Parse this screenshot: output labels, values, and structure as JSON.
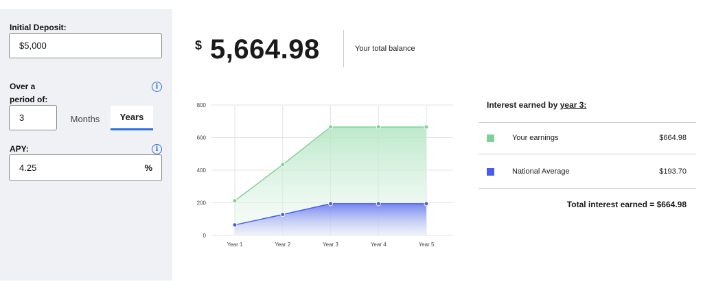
{
  "form": {
    "deposit_label": "Initial Deposit:",
    "deposit_value": "$5,000",
    "period_label_line1": "Over a",
    "period_label_line2": "period of:",
    "period_value": "3",
    "tab_months": "Months",
    "tab_years": "Years",
    "selected_tab": "Years",
    "apy_label": "APY:",
    "apy_value": "4.25",
    "apy_unit": "%",
    "info_glyph": "i"
  },
  "summary": {
    "currency": "$",
    "total_balance": "5,664.98",
    "total_balance_label": "Your total balance"
  },
  "interest": {
    "title_prefix": "Interest earned by ",
    "title_link": "year 3:",
    "rows": [
      {
        "label": "Your earnings",
        "value": "$664.98",
        "color": "#7fd19a"
      },
      {
        "label": "National Average",
        "value": "$193.70",
        "color": "#4a5de8"
      }
    ],
    "total_label": "Total interest earned = $664.98"
  },
  "chart_data": {
    "type": "area",
    "categories": [
      "Year 1",
      "Year 2",
      "Year 3",
      "Year 4",
      "Year 5"
    ],
    "y_ticks": [
      0,
      200,
      400,
      600,
      800
    ],
    "ylim": [
      0,
      800
    ],
    "grid": true,
    "series": [
      {
        "name": "Your earnings",
        "values": [
          212,
          434,
          665,
          665,
          665
        ],
        "color": "#7fd19a"
      },
      {
        "name": "National Average",
        "values": [
          64,
          128,
          194,
          194,
          194
        ],
        "color": "#4a5de8"
      }
    ]
  }
}
